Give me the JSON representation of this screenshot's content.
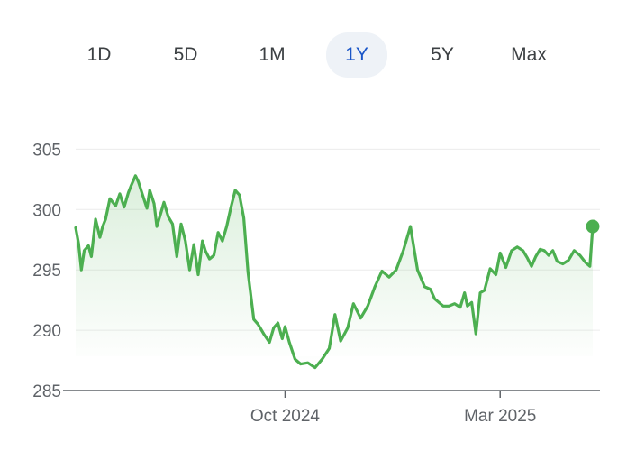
{
  "range_tabs": [
    {
      "label": "1D",
      "active": false
    },
    {
      "label": "5D",
      "active": false
    },
    {
      "label": "1M",
      "active": false
    },
    {
      "label": "1Y",
      "active": true
    },
    {
      "label": "5Y",
      "active": false
    },
    {
      "label": "Max",
      "active": false
    }
  ],
  "colors": {
    "line": "#4caf50",
    "active_tab_text": "#1a56c8",
    "active_tab_bg": "#eef2f7",
    "grid": "#ececec",
    "axis": "#5f6368"
  },
  "chart_data": {
    "type": "line",
    "title": "",
    "xlabel": "",
    "ylabel": "",
    "ylim": [
      285,
      306
    ],
    "y_ticks": [
      285,
      290,
      295,
      300,
      305
    ],
    "y_tick_labels": [
      "285",
      "290",
      "295",
      "300",
      "305"
    ],
    "x_tick_labels": [
      "Oct 2024",
      "Mar 2025"
    ],
    "x_tick_dates": [
      "2024-10-01",
      "2025-03-01"
    ],
    "grid": true,
    "last_point_marker": true,
    "series": [
      {
        "x": [
          "2024-05-07",
          "2024-05-09",
          "2024-05-11",
          "2024-05-13",
          "2024-05-16",
          "2024-05-18",
          "2024-05-21",
          "2024-05-24",
          "2024-05-26",
          "2024-05-28",
          "2024-05-31",
          "2024-06-04",
          "2024-06-07",
          "2024-06-10",
          "2024-06-13",
          "2024-06-15",
          "2024-06-18",
          "2024-06-20",
          "2024-06-23",
          "2024-06-26",
          "2024-06-28",
          "2024-07-01",
          "2024-07-03",
          "2024-07-06",
          "2024-07-08",
          "2024-07-11",
          "2024-07-14",
          "2024-07-17",
          "2024-07-20",
          "2024-07-23",
          "2024-07-26",
          "2024-07-29",
          "2024-08-01",
          "2024-08-04",
          "2024-08-06",
          "2024-08-09",
          "2024-08-12",
          "2024-08-15",
          "2024-08-18",
          "2024-08-21",
          "2024-08-24",
          "2024-08-27",
          "2024-08-30",
          "2024-09-02",
          "2024-09-05",
          "2024-09-09",
          "2024-09-12",
          "2024-09-16",
          "2024-09-20",
          "2024-09-23",
          "2024-09-26",
          "2024-09-29",
          "2024-10-01",
          "2024-10-04",
          "2024-10-08",
          "2024-10-12",
          "2024-10-17",
          "2024-10-22",
          "2024-10-27",
          "2024-11-01",
          "2024-11-05",
          "2024-11-09",
          "2024-11-14",
          "2024-11-18",
          "2024-11-23",
          "2024-11-28",
          "2024-12-03",
          "2024-12-08",
          "2024-12-13",
          "2024-12-18",
          "2024-12-23",
          "2024-12-28",
          "2025-01-02",
          "2025-01-07",
          "2025-01-11",
          "2025-01-14",
          "2025-01-17",
          "2025-01-20",
          "2025-01-24",
          "2025-01-28",
          "2025-02-01",
          "2025-02-04",
          "2025-02-06",
          "2025-02-09",
          "2025-02-12",
          "2025-02-15",
          "2025-02-18",
          "2025-02-22",
          "2025-02-26",
          "2025-03-01",
          "2025-03-05",
          "2025-03-09",
          "2025-03-13",
          "2025-03-17",
          "2025-03-20",
          "2025-03-23",
          "2025-03-26",
          "2025-03-29",
          "2025-04-01",
          "2025-04-04",
          "2025-04-07",
          "2025-04-10",
          "2025-04-14",
          "2025-04-18",
          "2025-04-22",
          "2025-04-26",
          "2025-04-30",
          "2025-05-03",
          "2025-05-05"
        ],
        "values": [
          298.5,
          297.2,
          295.0,
          296.6,
          297.0,
          296.1,
          299.2,
          297.7,
          298.6,
          299.2,
          300.9,
          300.3,
          301.3,
          300.2,
          301.4,
          302.0,
          302.8,
          302.3,
          301.2,
          300.1,
          301.6,
          300.5,
          298.6,
          299.8,
          300.6,
          299.4,
          298.8,
          296.1,
          298.8,
          297.4,
          295.0,
          297.1,
          294.6,
          297.4,
          296.6,
          295.9,
          296.2,
          298.1,
          297.4,
          298.6,
          300.2,
          301.6,
          301.2,
          299.3,
          294.8,
          290.9,
          290.5,
          289.7,
          289.0,
          290.2,
          290.6,
          289.3,
          290.3,
          289.0,
          287.6,
          287.2,
          287.3,
          286.9,
          287.6,
          288.5,
          291.3,
          289.1,
          290.2,
          292.2,
          291.0,
          292.0,
          293.6,
          294.9,
          294.4,
          295.0,
          296.6,
          298.6,
          295.0,
          293.6,
          293.4,
          292.6,
          292.3,
          292.0,
          292.0,
          292.2,
          291.9,
          293.1,
          292.0,
          292.3,
          289.7,
          293.1,
          293.3,
          295.1,
          294.6,
          296.4,
          295.2,
          296.6,
          296.9,
          296.6,
          296.0,
          295.3,
          296.1,
          296.7,
          296.6,
          296.2,
          296.6,
          295.7,
          295.5,
          295.8,
          296.6,
          296.2,
          295.6,
          295.3,
          298.6
        ]
      }
    ]
  }
}
